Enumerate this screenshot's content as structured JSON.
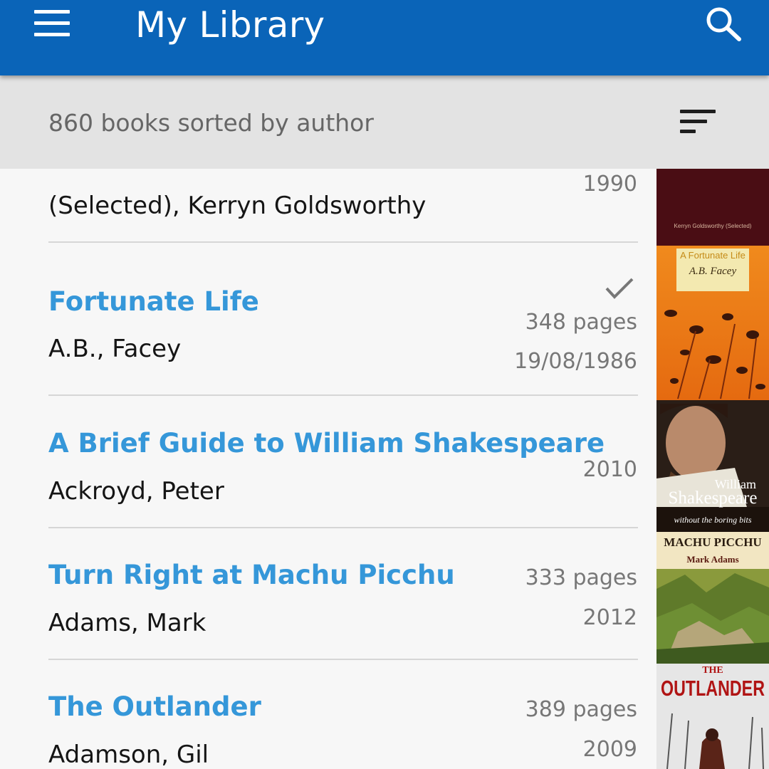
{
  "appbar": {
    "title": "My Library",
    "menu_icon": "menu-icon",
    "search_icon": "search-icon",
    "color": "#0a64b8"
  },
  "subbar": {
    "summary": "860 books sorted by author",
    "sort_icon": "sort-icon"
  },
  "books": [
    {
      "title": "",
      "author": "(Selected), Kerryn Goldsworthy",
      "pages": "",
      "date": "1990",
      "read": false,
      "cover_text": "Kerryn Goldsworthy (Selected)"
    },
    {
      "title": "Fortunate Life",
      "author": "A.B., Facey",
      "pages": "348 pages",
      "date": "19/08/1986",
      "read": true,
      "cover_text": "A Fortunate Life",
      "cover_subtext": "A.B. Facey"
    },
    {
      "title": "A Brief Guide to William Shakespeare",
      "author": "Ackroyd, Peter",
      "pages": "",
      "date": "2010",
      "read": false,
      "cover_text": "William",
      "cover_subtext": "Shakespeare",
      "cover_tagline": "without the boring bits"
    },
    {
      "title": "Turn Right at Machu Picchu",
      "author": "Adams, Mark",
      "pages": "333 pages",
      "date": "2012",
      "read": false,
      "cover_text": "MACHU PICCHU",
      "cover_subtext": "Mark Adams"
    },
    {
      "title": "The Outlander",
      "author": "Adamson, Gil",
      "pages": "389 pages",
      "date": "2009",
      "read": false,
      "cover_text": "THE",
      "cover_subtext": "OUTLANDER"
    }
  ],
  "colors": {
    "title_accent": "#3597d9",
    "check": "#777777"
  }
}
